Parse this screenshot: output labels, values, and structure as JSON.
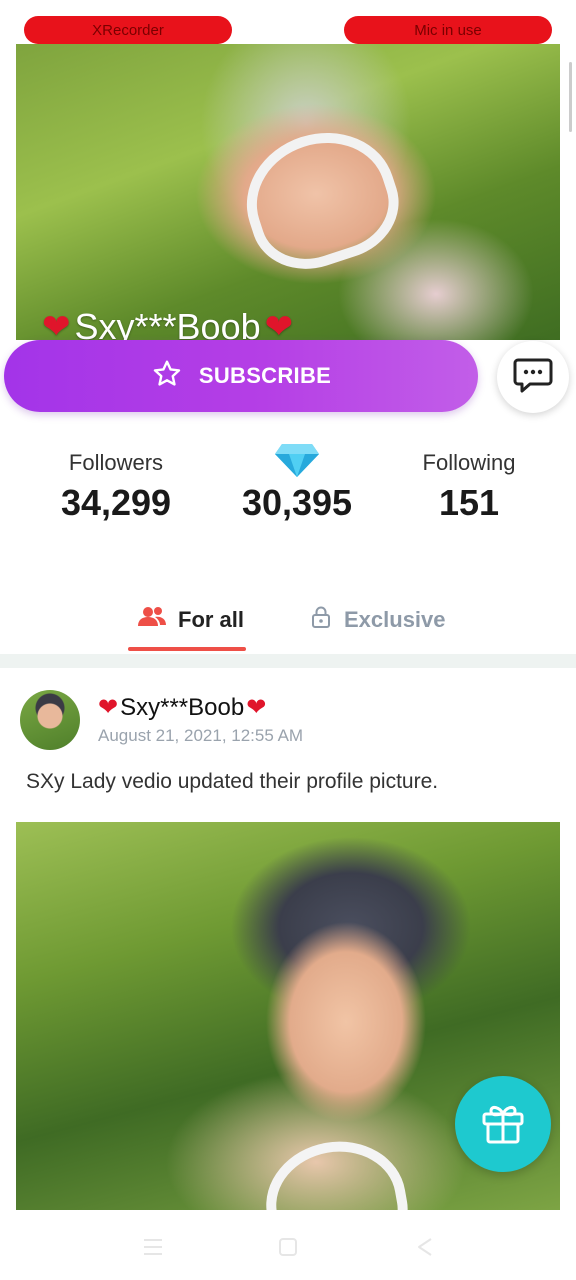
{
  "recorder": {
    "left_label": "XRecorder",
    "right_label": "Mic in use",
    "color": "#e8121b"
  },
  "profile": {
    "name": "Sxy***Boob",
    "subscribe_label": "SUBSCRIBE",
    "accent": "#a334e8"
  },
  "stats": {
    "followers_label": "Followers",
    "followers_value": "34,299",
    "diamonds_value": "30,395",
    "following_label": "Following",
    "following_value": "151"
  },
  "tabs": [
    {
      "label": "For all",
      "icon": "group-icon",
      "active": true
    },
    {
      "label": "Exclusive",
      "icon": "lock-icon",
      "active": false
    }
  ],
  "post": {
    "author": "Sxy***Boob",
    "date": "August 21, 2021, 12:55 AM",
    "text": "SXy Lady vedio updated their profile picture."
  },
  "icons": {
    "chat": "chat-icon",
    "gift": "gift-icon",
    "diamond": "diamond-icon",
    "star": "star-icon"
  },
  "colors": {
    "tab_underline": "#ee4f47",
    "gift_button": "#1ec9cf",
    "diamond": "#3ec3ee"
  }
}
